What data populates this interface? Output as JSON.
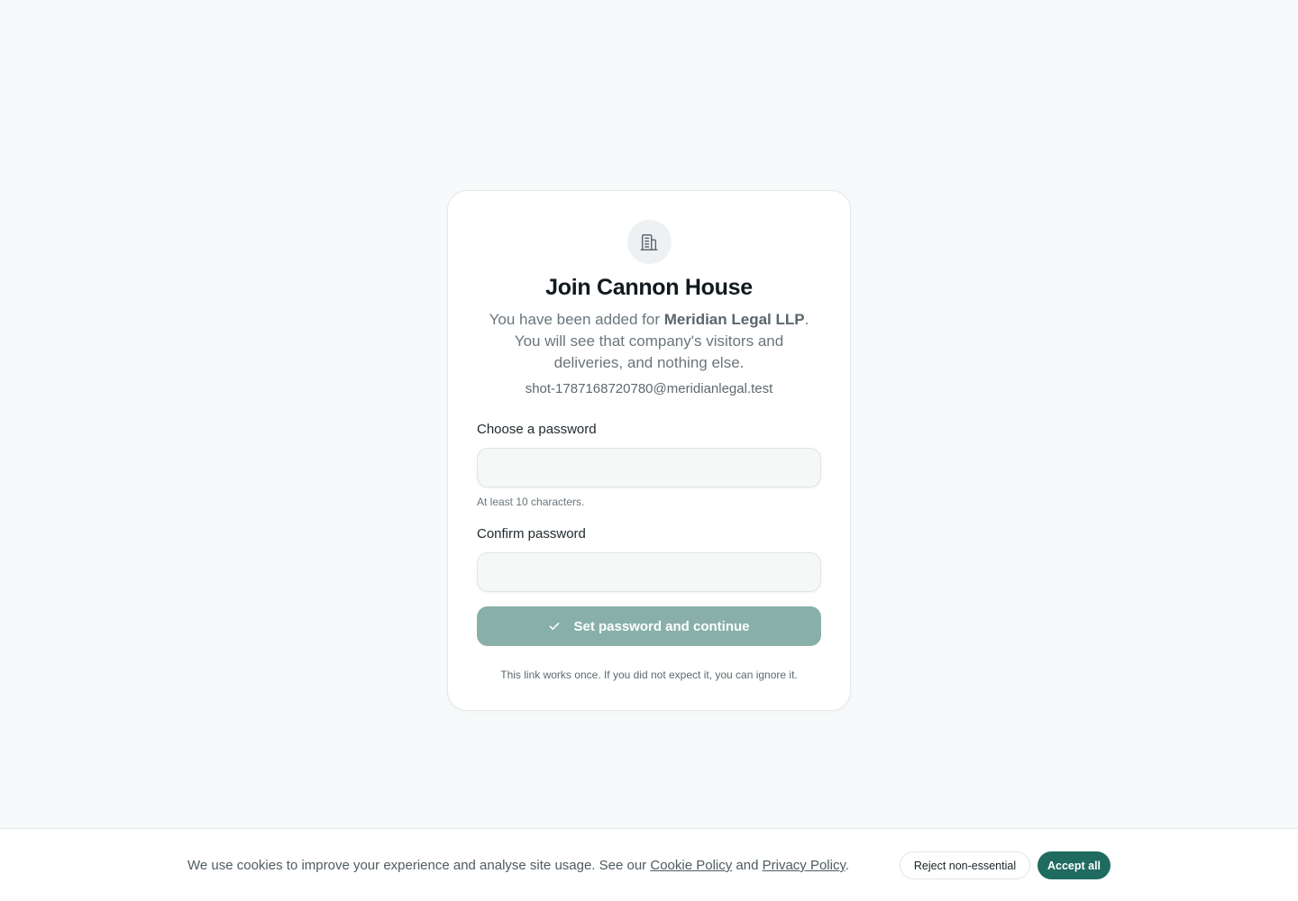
{
  "card": {
    "icon": "building-icon",
    "title": "Join Cannon House",
    "subtitle_before": "You have been added for ",
    "company": "Meridian Legal LLP",
    "subtitle_after": ". You will see that company's visitors and deliveries, and nothing else.",
    "email": "shot-1787168720780@meridianlegal.test"
  },
  "form": {
    "password_label": "Choose a password",
    "password_value": "",
    "password_hint": "At least 10 characters.",
    "confirm_label": "Confirm password",
    "confirm_value": "",
    "submit_icon": "check-icon",
    "submit_label": "Set password and continue",
    "footnote": "This link works once. If you did not expect it, you can ignore it."
  },
  "cookies": {
    "text_before": "We use cookies to improve your experience and analyse site usage. See our ",
    "cookie_policy_link": "Cookie Policy",
    "text_and": " and ",
    "privacy_policy_link": "Privacy Policy",
    "text_end": ".",
    "reject_label": "Reject non-essential",
    "accept_label": "Accept all"
  },
  "colors": {
    "accent": "#1f6b5f",
    "submit_disabled": "#88b0a9",
    "background": "#f7f9fa"
  }
}
